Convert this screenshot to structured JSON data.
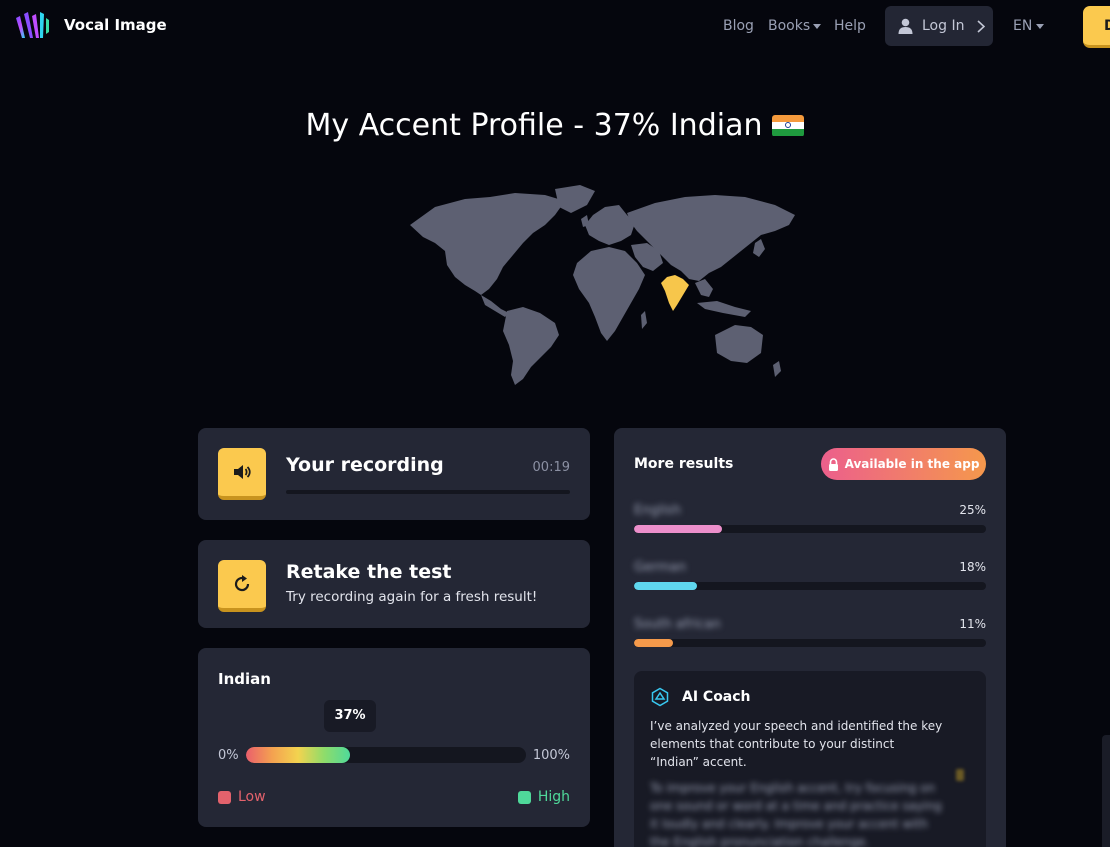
{
  "nav": {
    "brand": "Vocal Image",
    "links": [
      {
        "label": "Blog"
      },
      {
        "label": "Books"
      },
      {
        "label": "Help"
      }
    ],
    "login_label": "Log In",
    "language": "EN",
    "download_label": "D"
  },
  "page": {
    "title": "My Accent Profile - 37% Indian",
    "flag": "india-flag",
    "map_highlight_color": "#f7c64b",
    "map_land_color": "#5d6072"
  },
  "recording": {
    "title": "Your recording",
    "duration": "00:19",
    "icon": "speaker-icon"
  },
  "retake": {
    "title": "Retake the test",
    "subtitle": "Try recording again for a fresh result!",
    "icon": "refresh-icon"
  },
  "scale": {
    "accent": "Indian",
    "percent": 37,
    "percent_label": "37%",
    "min_label": "0%",
    "max_label": "100%",
    "legend": [
      {
        "label": "Low",
        "color": "#e3626c"
      },
      {
        "label": "High",
        "color": "#4fd99a"
      }
    ]
  },
  "more_results": {
    "title": "More results",
    "badge": "Available in the app",
    "badge_icon": "lock-icon",
    "items": [
      {
        "name": "English",
        "percent": 25,
        "value": "25%",
        "color": "#ec8fcb"
      },
      {
        "name": "German",
        "percent": 18,
        "value": "18%",
        "color": "#5fd7ee"
      },
      {
        "name": "South african",
        "percent": 11,
        "value": "11%",
        "color": "#f59a4b"
      }
    ]
  },
  "ai_coach": {
    "title": "AI Coach",
    "icon": "ai-coach-icon",
    "text": "I’ve analyzed your speech and identified the key elements that contribute to your distinct “Indian” accent.",
    "blurred_text": "To improve your English accent, try focusing on one sound or word at a time and practice saying it loudly and clearly. Improve your accent with the English pronunciation challenge."
  }
}
